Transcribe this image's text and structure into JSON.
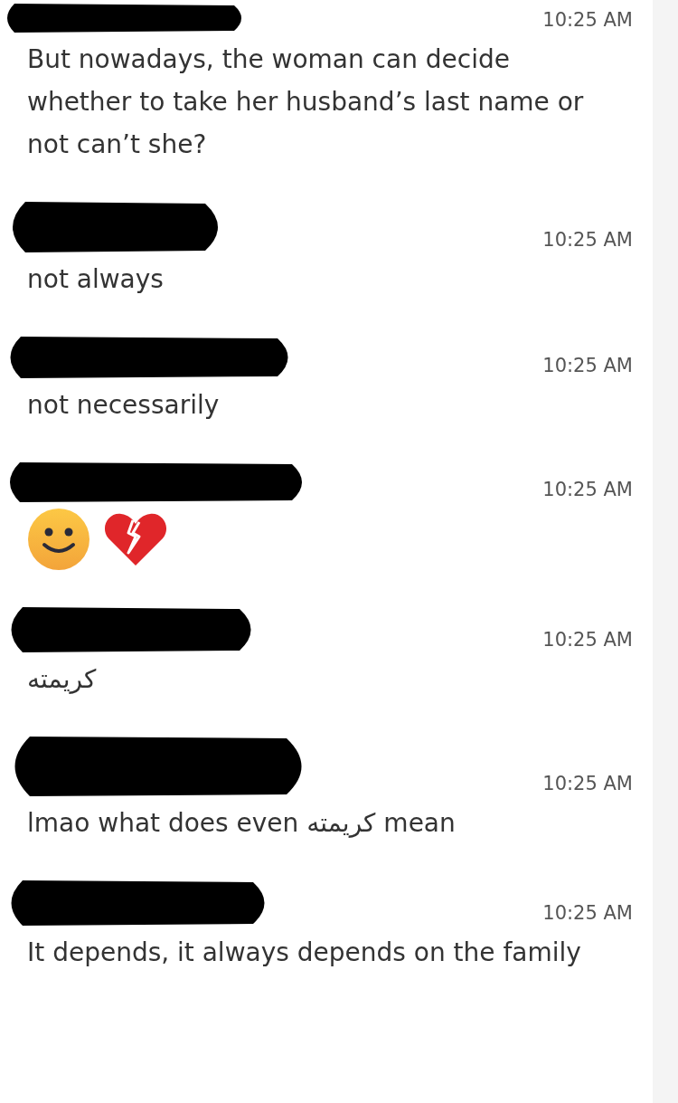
{
  "messages": [
    {
      "time": "10:25 AM",
      "kind": "text",
      "text": "But nowadays, the woman can decide whether to take her husband’s last name or not can’t she?"
    },
    {
      "time": "10:25 AM",
      "kind": "text",
      "text": "not always"
    },
    {
      "time": "10:25 AM",
      "kind": "text",
      "text": "not necessarily"
    },
    {
      "time": "10:25 AM",
      "kind": "emojis",
      "emojis": [
        {
          "kind": "smile"
        },
        {
          "kind": "broken-heart"
        }
      ]
    },
    {
      "time": "10:25 AM",
      "kind": "text",
      "text": "كريمته"
    },
    {
      "time": "10:25 AM",
      "kind": "text",
      "text": "lmao what does even كريمته mean"
    },
    {
      "time": "10:25 AM",
      "kind": "text",
      "text": "It depends, it always depends on the family"
    }
  ]
}
